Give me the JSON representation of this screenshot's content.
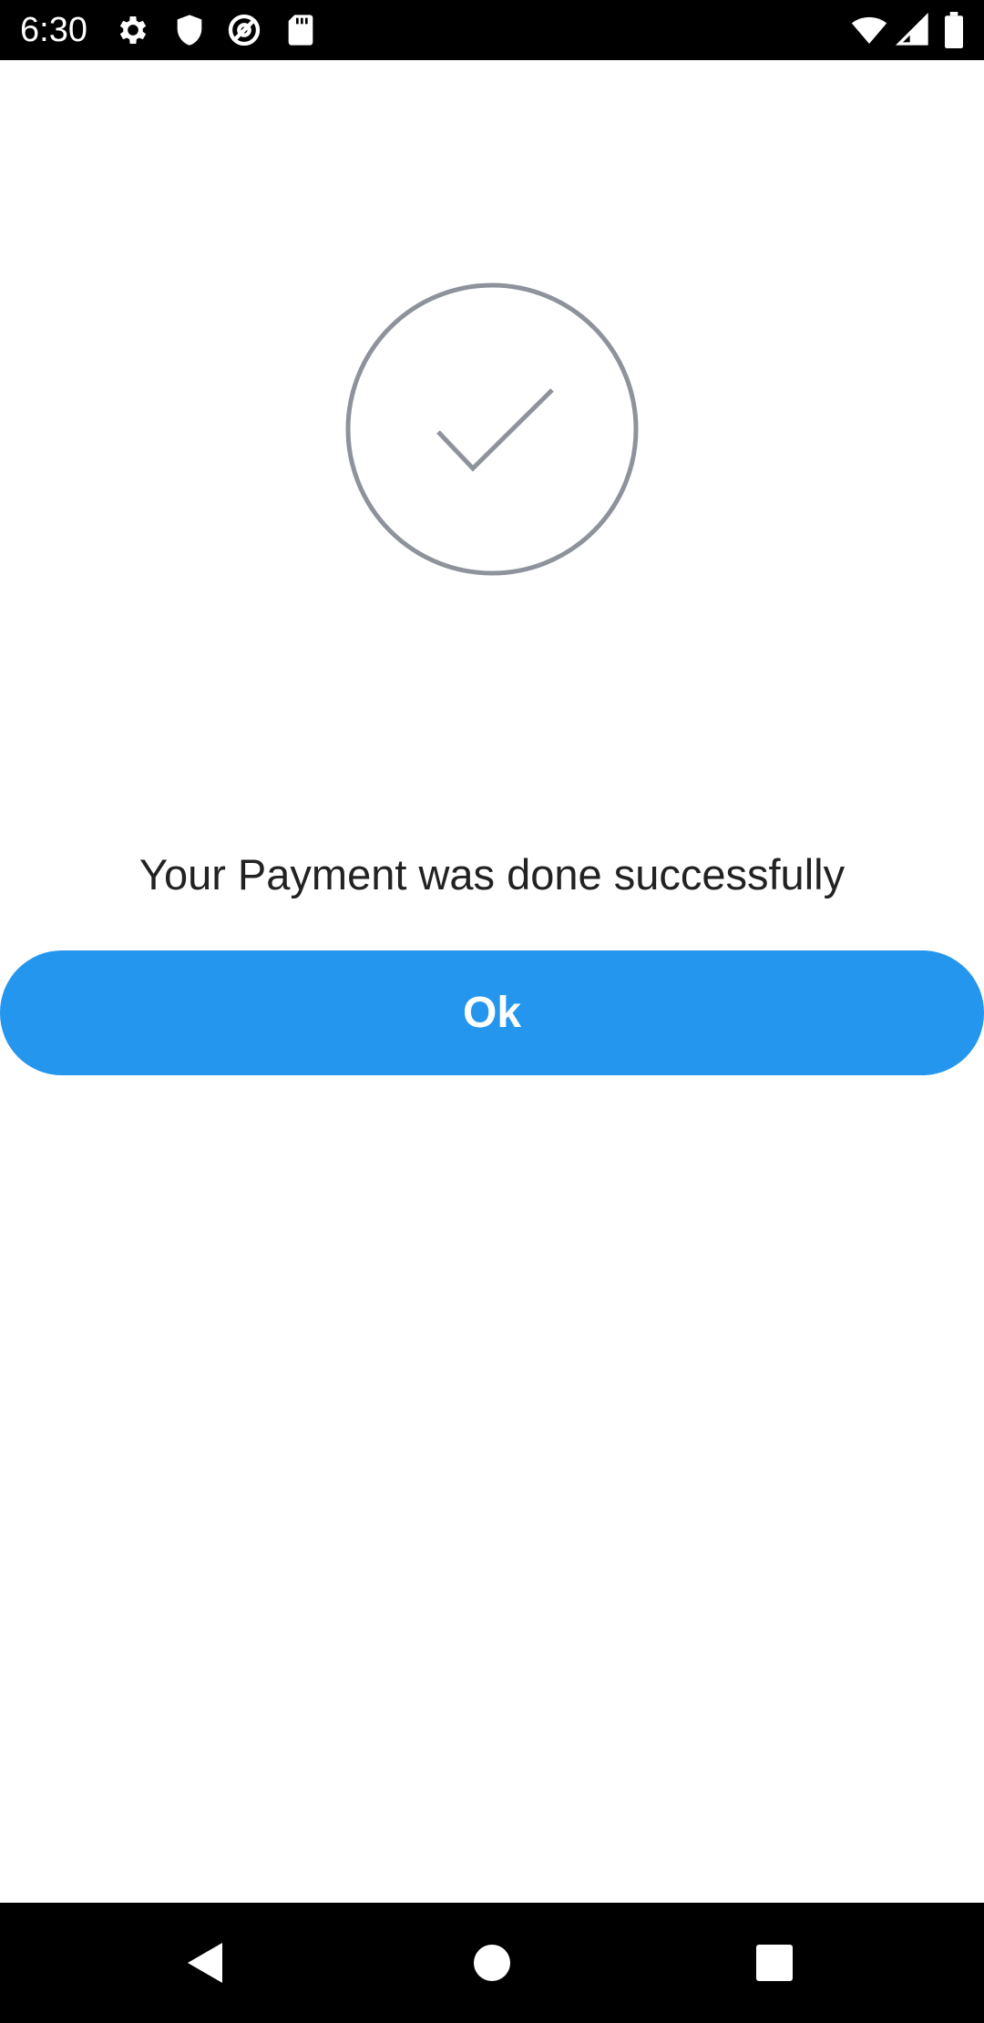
{
  "status_bar": {
    "time": "6:30",
    "left_icons": [
      "gear-icon",
      "shield-icon",
      "at-sign-icon",
      "sd-card-icon"
    ],
    "right_icons": [
      "wifi-icon",
      "cell-signal-icon",
      "battery-icon"
    ]
  },
  "content": {
    "status_icon": "check-circle-icon",
    "message": "Your Payment was done successfully",
    "ok_label": "Ok"
  },
  "nav_bar": {
    "buttons": [
      "back-icon",
      "home-icon",
      "recents-icon"
    ]
  },
  "colors": {
    "accent": "#2496ee",
    "circle_stroke": "#8e939b",
    "bars": "#000000",
    "text": "#222222"
  }
}
